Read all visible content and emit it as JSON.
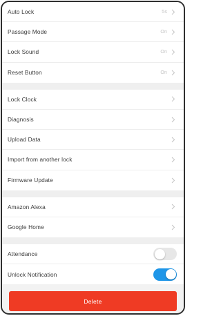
{
  "groups": [
    {
      "name": "lock-settings",
      "rows": [
        {
          "id": "auto-lock",
          "label": "Auto Lock",
          "value": "5s"
        },
        {
          "id": "passage-mode",
          "label": "Passage Mode",
          "value": "On"
        },
        {
          "id": "lock-sound",
          "label": "Lock Sound",
          "value": "On"
        },
        {
          "id": "reset-button",
          "label": "Reset Button",
          "value": "On"
        }
      ]
    },
    {
      "name": "lock-tools",
      "rows": [
        {
          "id": "lock-clock",
          "label": "Lock Clock"
        },
        {
          "id": "diagnosis",
          "label": "Diagnosis"
        },
        {
          "id": "upload-data",
          "label": "Upload Data"
        },
        {
          "id": "import-from-another-lock",
          "label": "Import from another lock"
        },
        {
          "id": "firmware-update",
          "label": "Firmware Update"
        }
      ]
    },
    {
      "name": "integrations",
      "rows": [
        {
          "id": "amazon-alexa",
          "label": "Amazon Alexa"
        },
        {
          "id": "google-home",
          "label": "Google Home"
        }
      ]
    }
  ],
  "toggles": [
    {
      "id": "attendance",
      "label": "Attendance",
      "on": false
    },
    {
      "id": "unlock-notification",
      "label": "Unlock Notification",
      "on": true
    }
  ],
  "delete_label": "Delete",
  "colors": {
    "accent": "#1e96e8",
    "danger": "#ef3b24"
  }
}
